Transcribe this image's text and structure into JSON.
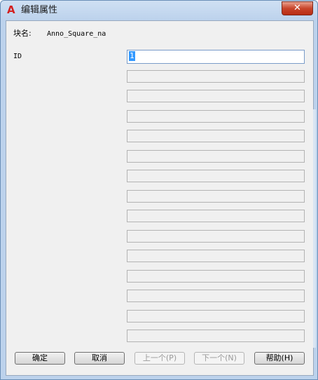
{
  "window": {
    "title": "编辑属性",
    "close_symbol": "✕",
    "app_icon_glyph": "A"
  },
  "block": {
    "name_label": "块名:",
    "name_value": "Anno_Square_na"
  },
  "attributes": [
    {
      "label": "ID",
      "value": "1"
    },
    {
      "label": "",
      "value": ""
    },
    {
      "label": "",
      "value": ""
    },
    {
      "label": "",
      "value": ""
    },
    {
      "label": "",
      "value": ""
    },
    {
      "label": "",
      "value": ""
    },
    {
      "label": "",
      "value": ""
    },
    {
      "label": "",
      "value": ""
    },
    {
      "label": "",
      "value": ""
    },
    {
      "label": "",
      "value": ""
    },
    {
      "label": "",
      "value": ""
    },
    {
      "label": "",
      "value": ""
    },
    {
      "label": "",
      "value": ""
    },
    {
      "label": "",
      "value": ""
    },
    {
      "label": "",
      "value": ""
    }
  ],
  "buttons": {
    "ok": "确定",
    "cancel": "取消",
    "prev": "上一个(P)",
    "next": "下一个(N)",
    "help": "帮助(H)"
  }
}
